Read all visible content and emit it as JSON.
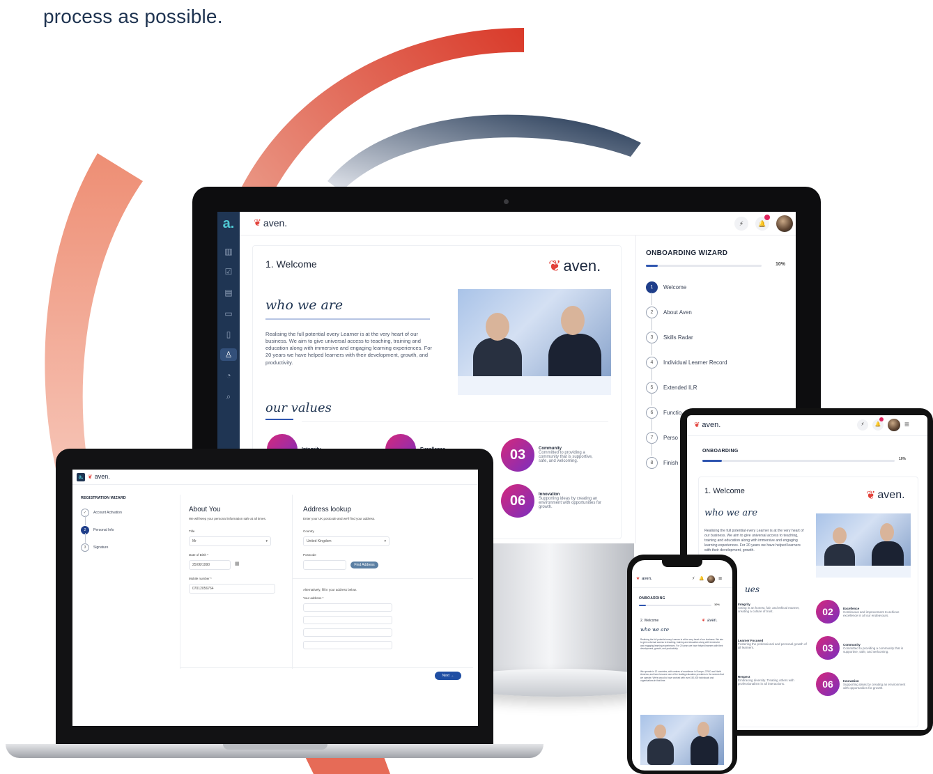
{
  "tagline": "process as possible.",
  "brand": {
    "name": "aven.",
    "app_icon": "a."
  },
  "colors": {
    "navy": "#1f3553",
    "accent": "#2f56b0",
    "magenta": "#d4287b",
    "orange": "#e2513a"
  },
  "monitor": {
    "header": {
      "notification_count": "3"
    },
    "welcome": {
      "title": "1. Welcome",
      "who_heading": "who we are",
      "who_text": "Realising the full potential every Learner is at the very heart of our business. We aim to give universal access to teaching, training and education along with immersive and engaging learning experiences. For 20 years we have helped learners with their development, growth, and productivity.",
      "values_heading": "our values",
      "values": [
        {
          "num": "",
          "name": "Integrity",
          "desc": ""
        },
        {
          "num": "",
          "name": "Excellence",
          "desc": ""
        },
        {
          "num": "03",
          "name": "Community",
          "desc": "Committed to providing a community that is supportive, safe, and welcoming."
        },
        {
          "num": "06",
          "name": "Innovation",
          "desc": "Supporting ideas by creating an environment with opportunities for growth."
        }
      ]
    },
    "wizard": {
      "title": "ONBOARDING WIZARD",
      "progress_label": "10%",
      "progress": 0.1,
      "steps": [
        {
          "n": "1",
          "label": "Welcome"
        },
        {
          "n": "2",
          "label": "About Aven"
        },
        {
          "n": "3",
          "label": "Skills Radar"
        },
        {
          "n": "4",
          "label": "Individual Learner Record"
        },
        {
          "n": "5",
          "label": "Extended ILR"
        },
        {
          "n": "6",
          "label": "Functio"
        },
        {
          "n": "7",
          "label": "Perso"
        },
        {
          "n": "8",
          "label": "Finish"
        }
      ]
    }
  },
  "laptop": {
    "wizard_title": "REGISTRATION WIZARD",
    "steps": [
      {
        "n": "✓",
        "label": "Account Activation"
      },
      {
        "n": "2",
        "label": "Personal Info"
      },
      {
        "n": "3",
        "label": "Signature"
      }
    ],
    "about": {
      "title": "About You",
      "subtitle": "We will keep your personal information safe at all times.",
      "title_label": "Title",
      "title_value": "Mr",
      "dob_label": "Date of Birth *",
      "dob_value": "25/06/1990",
      "mobile_label": "Mobile number *",
      "mobile_value": "07012056764"
    },
    "address": {
      "title": "Address lookup",
      "subtitle": "Enter your UK postcode and we'll find your address.",
      "country_label": "Country",
      "country_value": "United Kingdom",
      "postcode_label": "Postcode",
      "find_button": "Find Address",
      "manual_text": "Alternatively, fill in your address below.",
      "your_address_label": "Your address *"
    },
    "next_button": "Next →"
  },
  "tablet": {
    "wizard_title": "ONBOARDING",
    "progress_label": "10%",
    "progress": 0.1,
    "title": "1. Welcome",
    "who_heading": "who we are",
    "who_text": "Realising the full potential every Learner is at the very heart of our business. We aim to give universal access to teaching, training and education along with immersive and engaging learning experiences. For 20 years we have helped learners with their development, growth.",
    "values_heading": "ues",
    "left_values": [
      {
        "name": "Integrity",
        "desc": "Acting in an honest, fair, and ethical manner, creating a culture of trust."
      },
      {
        "name": "Learner Focused",
        "desc": "Fostering the professional and personal growth of all learners."
      },
      {
        "name": "Respect",
        "desc": "Embracing diversity. Treating others with professionalism in all interactions."
      }
    ],
    "right_values": [
      {
        "num": "02",
        "name": "Excellence",
        "desc": "Continuous and improvement to achieve excellence in all our endeavours."
      },
      {
        "num": "03",
        "name": "Community",
        "desc": "Committed to providing a community that is supportive, safe, and welcoming."
      },
      {
        "num": "06",
        "name": "Innovation",
        "desc": "Supporting ideas by creating an environment with opportunities for growth."
      }
    ]
  },
  "phone": {
    "wizard_title": "ONBOARDING",
    "progress_label": "10%",
    "progress": 0.1,
    "title": "2. Welcome",
    "who_heading": "who we are",
    "text1": "Realising the full potential every Learner is at the very heart of our business. We aim to give universal access to teaching, training and education along with immersive and engaging learning experiences. For 20 years we have helped learners with their development, growth, and productivity.",
    "text2": "We operate in 12 countries, with centres of excellence in Europe, CPAC and North America, and have become one of the leading education providers in the sectors that we operate. We're proud to have worked with over 150,000 individuals and organisations in that time."
  }
}
